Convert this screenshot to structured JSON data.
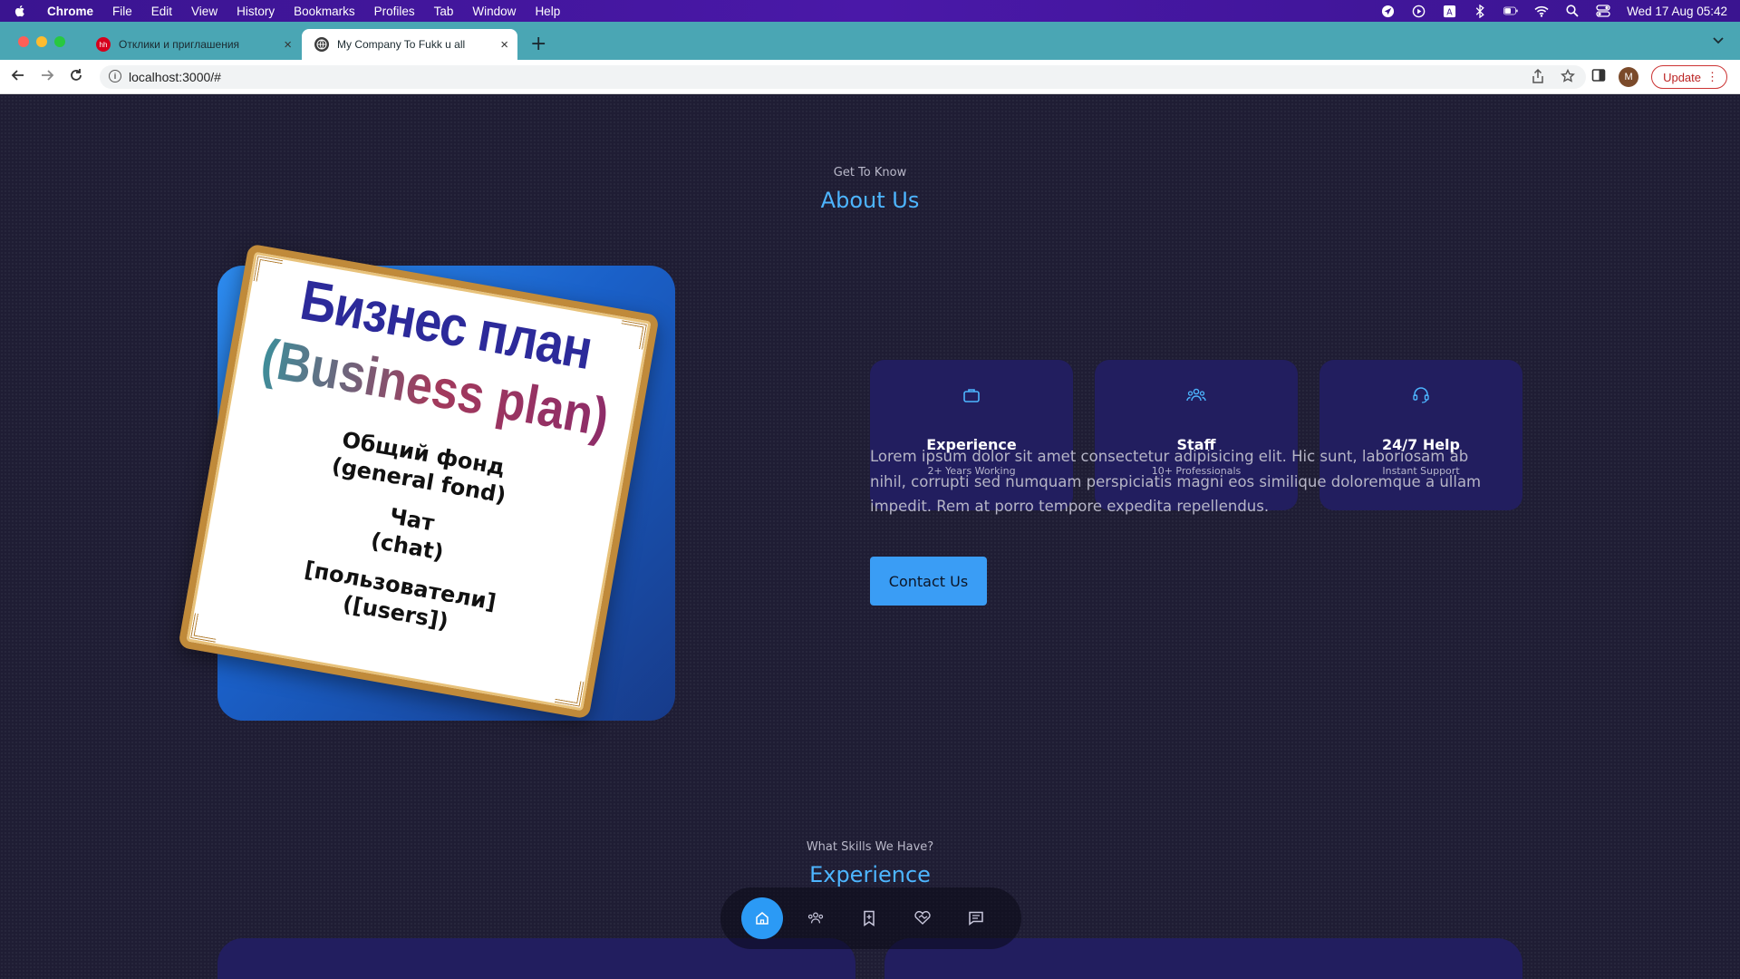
{
  "menubar": {
    "items": [
      "Chrome",
      "File",
      "Edit",
      "View",
      "History",
      "Bookmarks",
      "Profiles",
      "Tab",
      "Window",
      "Help"
    ],
    "datetime": "Wed 17 Aug  05:42"
  },
  "tabs": [
    {
      "title": "Отклики и приглашения",
      "favicon_text": "hh"
    },
    {
      "title": "My Company To Fukk u all"
    }
  ],
  "toolbar": {
    "url": "localhost:3000/#",
    "profile_initial": "M",
    "update_label": "Update"
  },
  "about": {
    "subtitle": "Get To Know",
    "title": "About Us",
    "poster": {
      "line1": "Бизнес план",
      "line2": "(Business plan)",
      "block1a": "Общий фонд",
      "block1b": "(general fond)",
      "block2a": "Чат",
      "block2b": "(chat)",
      "block3a": "[пользователи]",
      "block3b": "([users])"
    },
    "cards": [
      {
        "title": "Experience",
        "subtitle": "2+ Years Working",
        "icon": "briefcase-icon"
      },
      {
        "title": "Staff",
        "subtitle": "10+ Professionals",
        "icon": "people-icon"
      },
      {
        "title": "24/7 Help",
        "subtitle": "Instant Support",
        "icon": "headset-icon"
      }
    ],
    "paragraph": "Lorem ipsum dolor sit amet consectetur adipisicing elit. Hic sunt, laboriosam ab nihil, corrupti sed numquam perspiciatis magni eos similique doloremque a ullam impedit. Rem at porro tempore expedita repellendus.",
    "contact_label": "Contact Us"
  },
  "experience": {
    "subtitle": "What Skills We Have?",
    "title": "Experience"
  },
  "bottom_nav": [
    "home-icon",
    "people-icon",
    "bookmark-icon",
    "handshake-icon",
    "message-icon"
  ],
  "colors": {
    "accent": "#4db5ff",
    "button": "#3a9df5",
    "card": "#221e5f",
    "background": "#1f1d34"
  }
}
